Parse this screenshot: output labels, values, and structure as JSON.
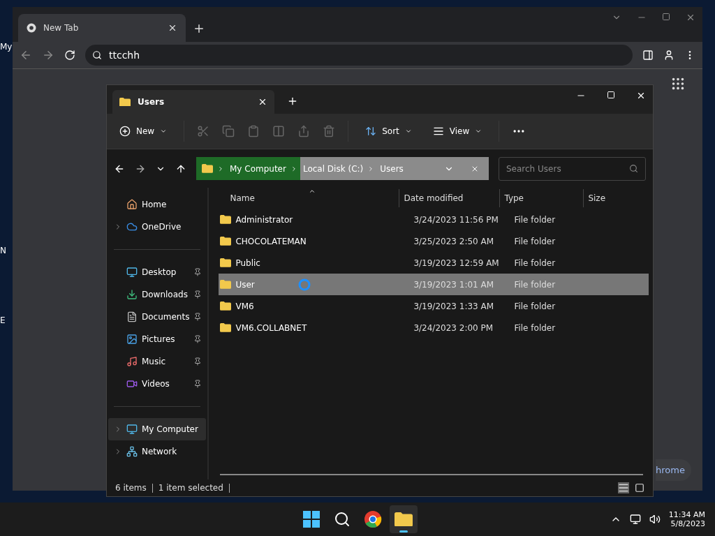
{
  "desktop": {
    "labels": [
      "My",
      "N",
      "E"
    ]
  },
  "browser": {
    "tab": "New Tab",
    "address": "ttcchh",
    "chip": "hrome"
  },
  "explorer": {
    "tab": "Users",
    "toolbar": [
      {
        "kind": "new",
        "label": "New"
      },
      {
        "kind": "sort",
        "label": "Sort"
      },
      {
        "kind": "view",
        "label": "View"
      }
    ],
    "breadcrumb": [
      {
        "label": "My Computer",
        "highlighted": true
      },
      {
        "label": "Local Disk (C:)",
        "highlighted": false
      },
      {
        "label": "Users",
        "highlighted": false
      }
    ],
    "search": {
      "placeholder": "Search Users"
    },
    "sidebar": [
      [
        {
          "label": "Home",
          "expandable": false,
          "pinned": false,
          "selected": false
        },
        {
          "label": "OneDrive",
          "expandable": true,
          "pinned": false,
          "selected": false
        }
      ],
      [
        {
          "label": "Desktop",
          "expandable": false,
          "pinned": true,
          "selected": false
        },
        {
          "label": "Downloads",
          "expandable": false,
          "pinned": true,
          "selected": false
        },
        {
          "label": "Documents",
          "expandable": false,
          "pinned": true,
          "selected": false
        },
        {
          "label": "Pictures",
          "expandable": false,
          "pinned": true,
          "selected": false
        },
        {
          "label": "Music",
          "expandable": false,
          "pinned": true,
          "selected": false
        },
        {
          "label": "Videos",
          "expandable": false,
          "pinned": true,
          "selected": false
        }
      ],
      [
        {
          "label": "My Computer",
          "expandable": true,
          "pinned": false,
          "selected": true
        },
        {
          "label": "Network",
          "expandable": true,
          "pinned": false,
          "selected": false
        }
      ]
    ],
    "columns": [
      "Name",
      "Date modified",
      "Type",
      "Size"
    ],
    "rows": [
      {
        "name": "Administrator",
        "date": "3/24/2023 11:56 PM",
        "type": "File folder",
        "selected": false
      },
      {
        "name": "CHOCOLATEMAN",
        "date": "3/25/2023 2:50 AM",
        "type": "File folder",
        "selected": false
      },
      {
        "name": "Public",
        "date": "3/19/2023 12:59 AM",
        "type": "File folder",
        "selected": false
      },
      {
        "name": "User",
        "date": "3/19/2023 1:01 AM",
        "type": "File folder",
        "selected": true
      },
      {
        "name": "VM6",
        "date": "3/19/2023 1:33 AM",
        "type": "File folder",
        "selected": false
      },
      {
        "name": "VM6.COLLABNET",
        "date": "3/24/2023 2:00 PM",
        "type": "File folder",
        "selected": false
      }
    ],
    "status": [
      "6 items",
      "1 item selected"
    ]
  },
  "taskbar": {
    "apps": [
      {
        "kind": "start",
        "selected": false
      },
      {
        "kind": "search",
        "selected": false
      },
      {
        "kind": "chrome",
        "selected": false
      },
      {
        "kind": "files",
        "selected": true
      }
    ],
    "time": "11:34 AM",
    "date": "5/8/2023"
  }
}
